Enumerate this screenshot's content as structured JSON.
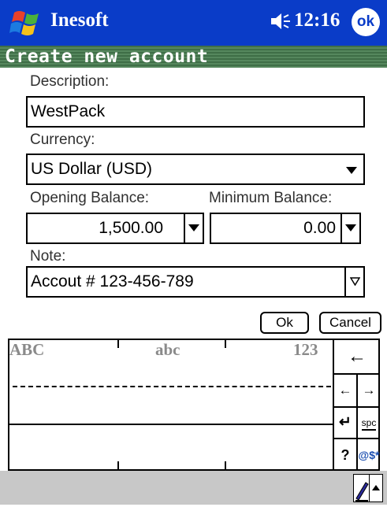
{
  "title_bar": {
    "app_name": "Inesoft",
    "time": "12:16",
    "ok_label": "ok",
    "start_logo": "windows-flag-icon",
    "volume_icon": "speaker-icon"
  },
  "form": {
    "header": "Create new account",
    "description_label": "Description:",
    "description_value": "WestPack",
    "currency_label": "Currency:",
    "currency_value": "US Dollar (USD)",
    "opening_balance_label": "Opening Balance:",
    "opening_balance_value": "1,500.00",
    "minimum_balance_label": "Minimum Balance:",
    "minimum_balance_value": "0.00",
    "note_label": "Note:",
    "note_value": "Accout # 123-456-789"
  },
  "buttons": {
    "ok": "Ok",
    "cancel": "Cancel"
  },
  "keyboard": {
    "mode_upper": "ABC",
    "mode_lower": "abc",
    "mode_numeric": "123",
    "backspace": "←",
    "left": "←",
    "right": "→",
    "enter": "↵",
    "space": "spc",
    "question": "?",
    "symbols": "@$*"
  },
  "colors": {
    "title_bar": "#0a3cc8",
    "header": "#4b7a52",
    "bottom_bar": "#c8c8c8"
  }
}
